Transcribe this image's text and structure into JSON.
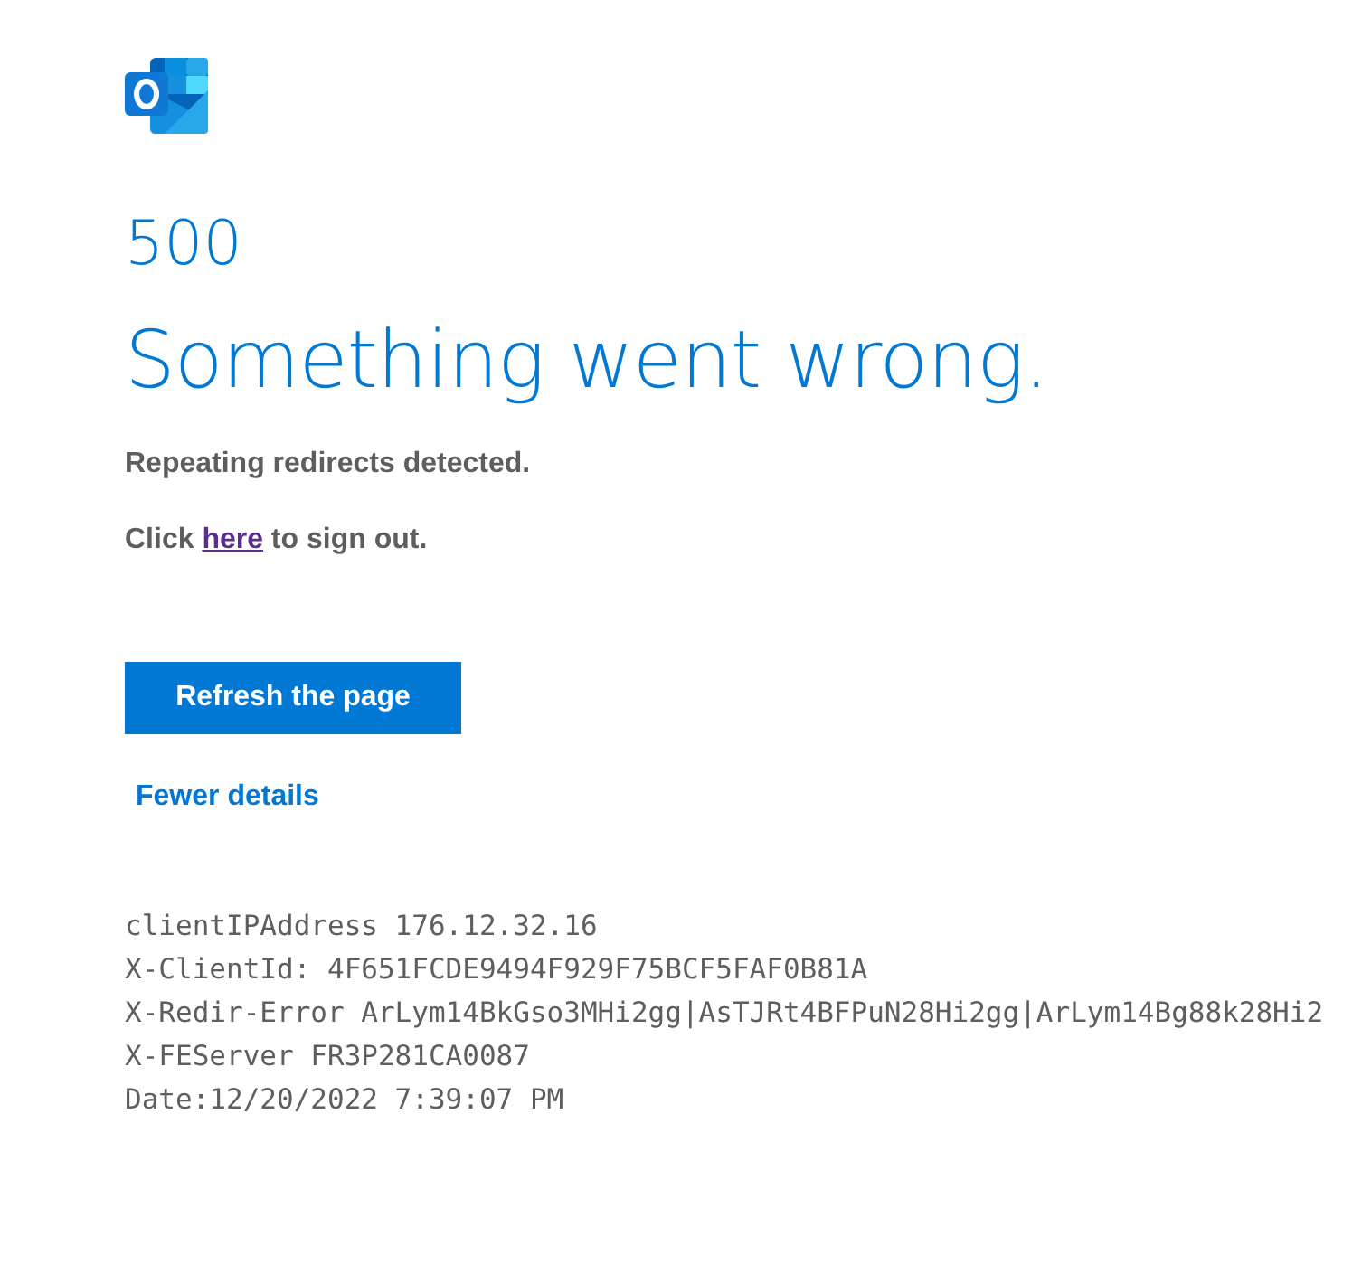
{
  "error_code": "500",
  "title": "Something went wrong.",
  "message": "Repeating redirects detected.",
  "sign_out": {
    "before": "Click ",
    "link": "here",
    "after": " to sign out."
  },
  "refresh_button": "Refresh the page",
  "details_toggle": "Fewer details",
  "details": [
    "clientIPAddress 176.12.32.16",
    "X-ClientId: 4F651FCDE9494F929F75BCF5FAF0B81A",
    "X-Redir-Error ArLym14BkGso3MHi2gg|AsTJRt4BFPuN28Hi2gg|ArLym14Bg88k28Hi2",
    "X-FEServer FR3P281CA0087",
    "Date:12/20/2022 7:39:07 PM"
  ]
}
